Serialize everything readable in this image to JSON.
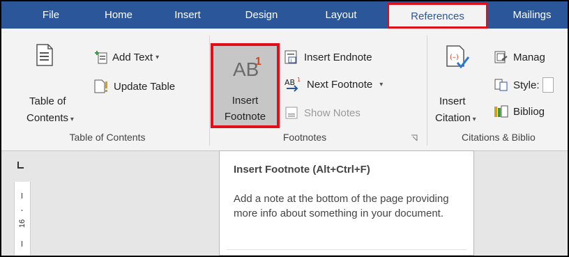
{
  "tabs": [
    {
      "id": "file",
      "label": "File"
    },
    {
      "id": "home",
      "label": "Home"
    },
    {
      "id": "insert",
      "label": "Insert"
    },
    {
      "id": "design",
      "label": "Design"
    },
    {
      "id": "layout",
      "label": "Layout"
    },
    {
      "id": "references",
      "label": "References"
    },
    {
      "id": "mailings",
      "label": "Mailings"
    }
  ],
  "active_tab": "References",
  "toc_group": {
    "label": "Table of Contents",
    "toc_button": {
      "line1": "Table of",
      "line2": "Contents"
    },
    "add_text": "Add Text",
    "update_table": "Update Table"
  },
  "footnotes_group": {
    "label": "Footnotes",
    "insert_footnote": {
      "glyph": "AB",
      "sup": "1",
      "line1": "Insert",
      "line2": "Footnote"
    },
    "insert_endnote": "Insert Endnote",
    "next_footnote": "Next Footnote",
    "show_notes": "Show Notes"
  },
  "citations_group": {
    "label": "Citations & Biblio",
    "insert_citation": {
      "line1": "Insert",
      "line2": "Citation"
    },
    "manage": "Manag",
    "style": "Style:",
    "bibliography": "Bibliog"
  },
  "ruler": {
    "number": "16"
  },
  "tooltip": {
    "title": "Insert Footnote (Alt+Ctrl+F)",
    "description": "Add a note at the bottom of the page providing more info about something in your document."
  },
  "colors": {
    "ribbon_blue": "#2b579a",
    "highlight_red": "#e0101a",
    "footnote_orange": "#d24726"
  }
}
